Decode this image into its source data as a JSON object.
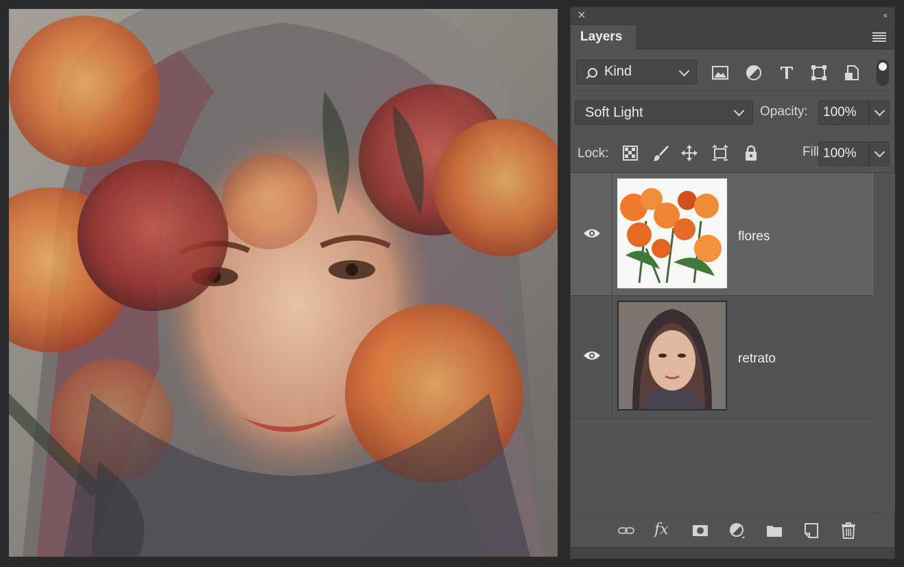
{
  "panel": {
    "tab_title": "Layers",
    "collapse_glyph": "‹‹",
    "close_glyph": "✕"
  },
  "filter": {
    "kind_label": "Kind",
    "icons": [
      "image-filter-icon",
      "adjustment-filter-icon",
      "type-filter-icon",
      "shape-filter-icon",
      "smart-object-filter-icon"
    ]
  },
  "blend": {
    "mode": "Soft Light",
    "opacity_label": "Opacity:",
    "opacity_value": "100%"
  },
  "lock": {
    "label": "Lock:",
    "fill_label": "Fill:",
    "fill_value": "100%"
  },
  "layers": [
    {
      "name": "flores",
      "visible": true,
      "selected": true
    },
    {
      "name": "retrato",
      "visible": true,
      "selected": false
    }
  ],
  "bottom_bar": {
    "fx_label": "fx",
    "icons": [
      "link-layers-icon",
      "fx-icon",
      "add-mask-icon",
      "new-adjustment-icon",
      "new-group-icon",
      "new-layer-icon",
      "delete-layer-icon"
    ]
  },
  "colors": {
    "panel_bg": "#535353",
    "selected_row": "#626262",
    "app_bg": "#2b2b2b"
  }
}
